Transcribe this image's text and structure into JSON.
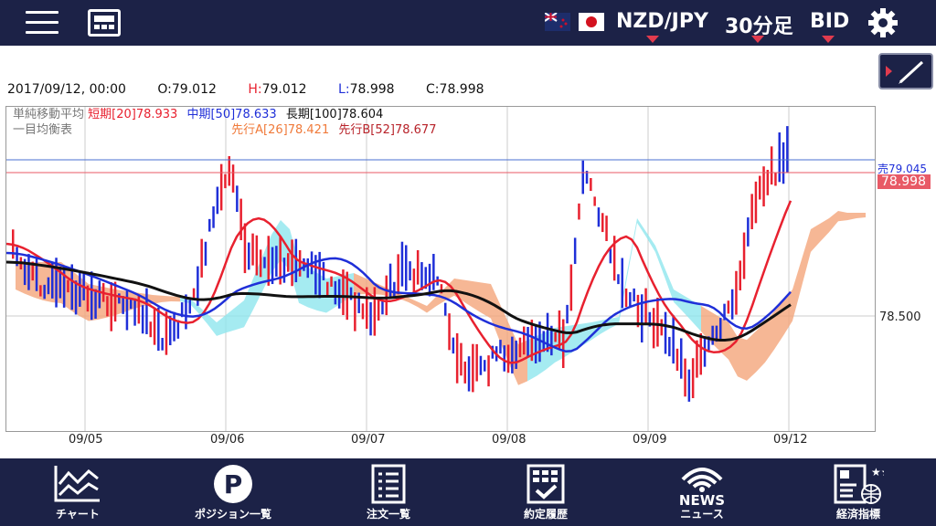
{
  "header": {
    "pair": "NZD/JPY",
    "timeframe": "30分足",
    "price_type": "BID"
  },
  "ohlc": {
    "datetime": "2017/09/12, 00:00",
    "open_label": "O:",
    "open": "79.012",
    "high_label": "H:",
    "high": "79.012",
    "low_label": "L:",
    "low": "78.998",
    "close_label": "C:",
    "close": "78.998"
  },
  "indicators": {
    "sma_title": "単純移動平均",
    "sma_short": "短期[20]78.933",
    "sma_mid": "中期[50]78.633",
    "sma_long": "長期[100]78.604",
    "ichimoku_title": "一目均衡表",
    "span_a": "先行A[26]78.421",
    "span_b": "先行B[52]78.677"
  },
  "price_axis": {
    "ask_label": "売79.045",
    "bid_label": "78.998",
    "level": "78.500"
  },
  "x_labels": [
    "09/05",
    "09/06",
    "09/07",
    "09/08",
    "09/09",
    "09/12"
  ],
  "nav": [
    {
      "label": "チャート"
    },
    {
      "label": "ポジション一覧"
    },
    {
      "label": "注文一覧"
    },
    {
      "label": "約定履歴"
    },
    {
      "label": "ニュース",
      "icon_text": "NEWS"
    },
    {
      "label": "経済指標"
    }
  ],
  "colors": {
    "bar_bg": "#1c2247",
    "bull": "#e8212f",
    "bear": "#1f2fd8",
    "sma_short": "#e8212f",
    "sma_mid": "#1f2fd8",
    "sma_long": "#111111",
    "cloud_up": "#f4a57a",
    "cloud_down": "#8ee6ee"
  }
}
